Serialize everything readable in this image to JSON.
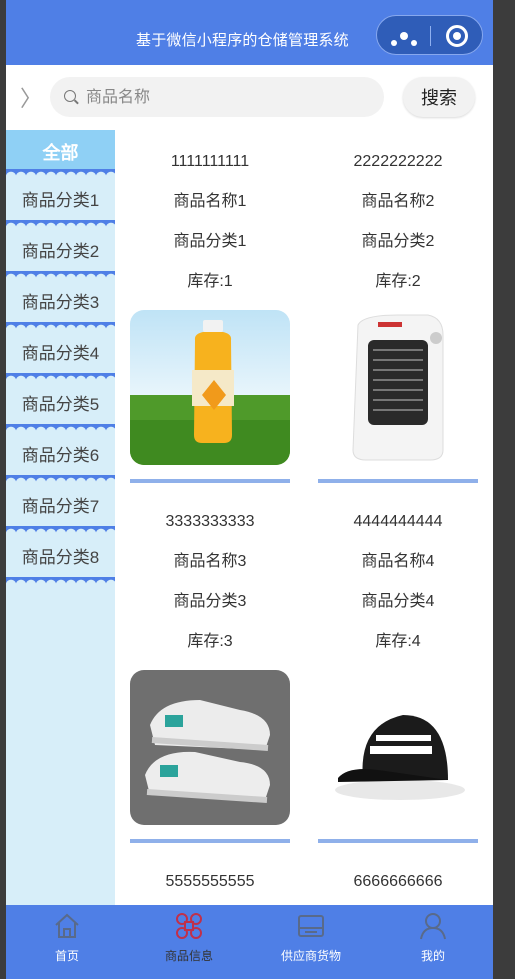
{
  "header": {
    "title": "基于微信小程序的仓储管理系统"
  },
  "search": {
    "placeholder": "商品名称",
    "button": "搜索"
  },
  "sidebar": {
    "items": [
      {
        "label": "全部"
      },
      {
        "label": "商品分类1"
      },
      {
        "label": "商品分类2"
      },
      {
        "label": "商品分类3"
      },
      {
        "label": "商品分类4"
      },
      {
        "label": "商品分类5"
      },
      {
        "label": "商品分类6"
      },
      {
        "label": "商品分类7"
      },
      {
        "label": "商品分类8"
      }
    ]
  },
  "products": [
    {
      "code": "1111111111",
      "name": "商品名称1",
      "category": "商品分类1",
      "stock": "库存:1"
    },
    {
      "code": "2222222222",
      "name": "商品名称2",
      "category": "商品分类2",
      "stock": "库存:2"
    },
    {
      "code": "3333333333",
      "name": "商品名称3",
      "category": "商品分类3",
      "stock": "库存:3"
    },
    {
      "code": "4444444444",
      "name": "商品名称4",
      "category": "商品分类4",
      "stock": "库存:4"
    },
    {
      "code": "5555555555"
    },
    {
      "code": "6666666666"
    }
  ],
  "tabbar": {
    "items": [
      {
        "label": "首页",
        "icon": "home-icon"
      },
      {
        "label": "商品信息",
        "icon": "command-icon"
      },
      {
        "label": "供应商货物",
        "icon": "box-icon"
      },
      {
        "label": "我的",
        "icon": "user-icon"
      }
    ]
  },
  "colors": {
    "primary": "#4f7fe6",
    "sidebar_bg": "#d7eef9",
    "active_cat": "#8fd0f5",
    "card_bar": "#8fb0ea"
  }
}
